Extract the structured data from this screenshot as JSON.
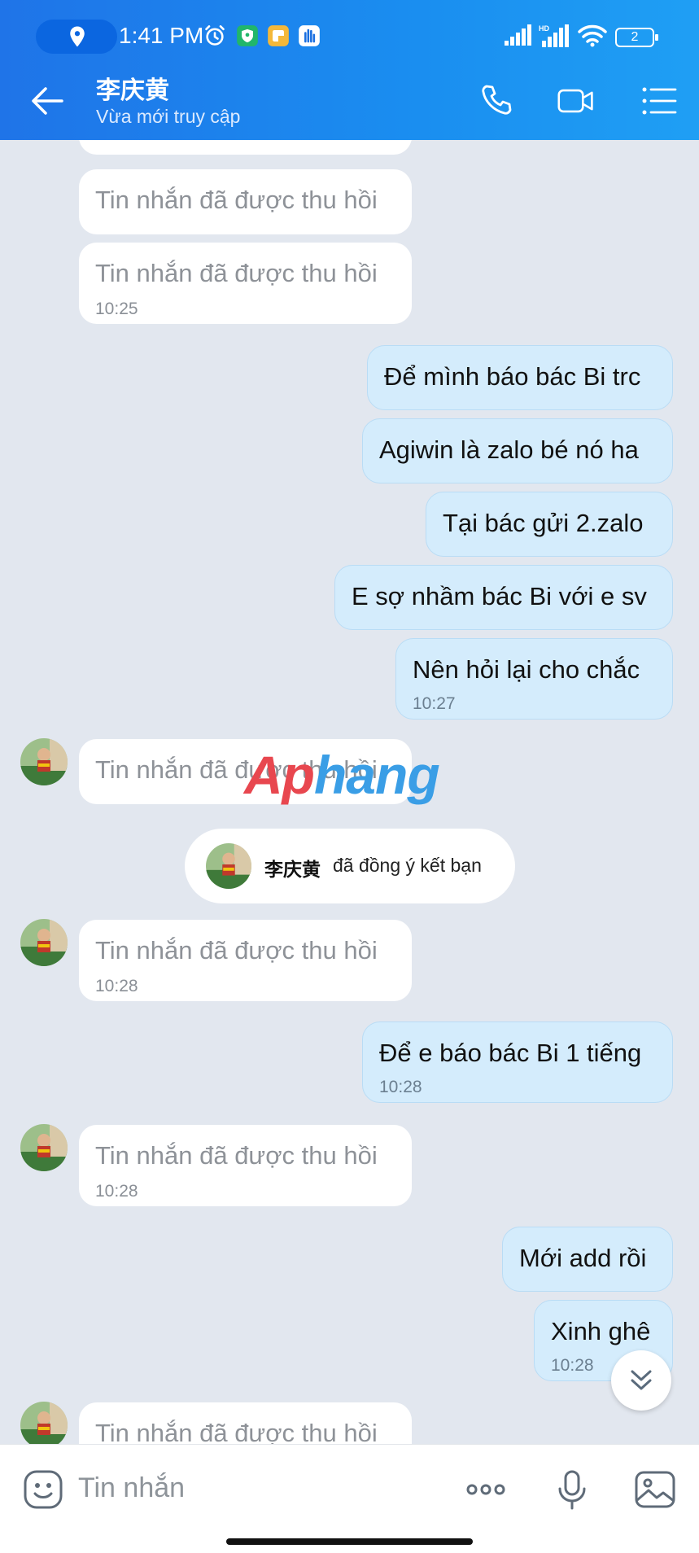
{
  "status_bar": {
    "time": "1:41 PM",
    "battery": "2",
    "network_badge": "HD"
  },
  "header": {
    "title": "李庆黄",
    "subtitle": "Vừa mới truy cập"
  },
  "messages": [
    {
      "text": "Tin nhắn đã được thu hồi"
    },
    {
      "text": "Tin nhắn đã được thu hồi",
      "time": "10:25"
    },
    {
      "text": "Để mình báo bác Bi trc"
    },
    {
      "text": "Agiwin là zalo bé nó ha"
    },
    {
      "text": "Tại bác gửi 2.zalo"
    },
    {
      "text": "E sợ nhầm bác Bi với e sv"
    },
    {
      "text": "Nên hỏi lại cho chắc",
      "time": "10:27"
    },
    {
      "text": "Tin nhắn đã được thu hồi"
    },
    {
      "text": "Tin nhắn đã được thu hồi",
      "time": "10:28"
    },
    {
      "text": "Để e báo bác Bi 1 tiếng",
      "time": "10:28"
    },
    {
      "text": "Tin nhắn đã được thu hồi",
      "time": "10:28"
    },
    {
      "text": "Mới add rồi"
    },
    {
      "text": "Xinh ghê",
      "time": "10:28"
    },
    {
      "text": "Tin nhắn đã được thu hồi"
    }
  ],
  "system_note": {
    "name": "李庆黄",
    "action": "đã đồng ý kết bạn"
  },
  "watermark": {
    "part1": "Ap",
    "part2": "hang"
  },
  "composer": {
    "placeholder": "Tin nhắn"
  },
  "colors": {
    "header": "#1a8ef0",
    "incoming": "#ffffff",
    "outgoing": "#d4ecfc",
    "background": "#e2e7ef"
  },
  "icons": [
    "location-icon",
    "alarm-icon",
    "shield-icon",
    "note-icon",
    "hand-icon",
    "signal-icon",
    "wifi-icon",
    "battery-icon",
    "back-arrow-icon",
    "phone-icon",
    "video-call-icon",
    "menu-icon",
    "chevron-double-down-icon",
    "emoji-icon",
    "more-icon",
    "microphone-icon",
    "image-icon"
  ]
}
